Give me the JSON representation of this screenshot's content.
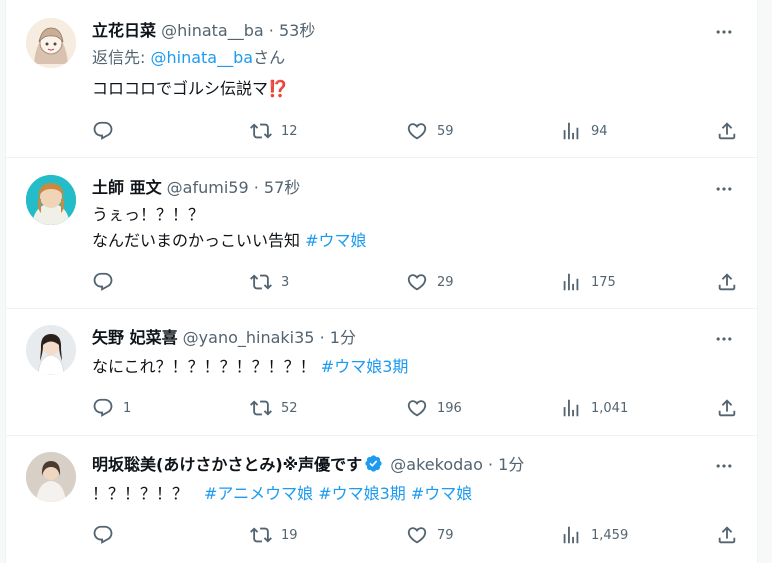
{
  "tweets": [
    {
      "name": "立花日菜",
      "handle": "@hinata__ba",
      "sep": "·",
      "time": "53秒",
      "reply_prefix": "返信先: ",
      "reply_to": "@hinata__ba",
      "reply_suffix": "さん",
      "text": "コロコロでゴルシ伝説マ⁉️",
      "replies": "",
      "retweets": "12",
      "likes": "59",
      "views": "94"
    },
    {
      "name": "土師 亜文",
      "handle": "@afumi59",
      "sep": "·",
      "time": "57秒",
      "line1": "うぇっ！？！？",
      "line2": "なんだいまのかっこいい告知 ",
      "hashtag1": "#ウマ娘",
      "replies": "",
      "retweets": "3",
      "likes": "29",
      "views": "175"
    },
    {
      "name": "矢野 妃菜喜",
      "handle": "@yano_hinaki35",
      "sep": "·",
      "time": "1分",
      "text": "なにこれ？！？！？！？！？！ ",
      "hashtag1": "#ウマ娘3期",
      "replies": "1",
      "retweets": "52",
      "likes": "196",
      "views": "1,041"
    },
    {
      "name": "明坂聡美(あけさかさとみ)※声優です",
      "handle": "@akekodao",
      "sep": "·",
      "time": "1分",
      "text": "！？！？！？　",
      "hashtag1": "#アニメウマ娘",
      "hashtag2": "#ウマ娘3期",
      "hashtag3": "#ウマ娘",
      "replies": "",
      "retweets": "19",
      "likes": "79",
      "views": "1,459"
    }
  ],
  "colors": {
    "link": "#1d9bf0",
    "secondary": "#536471",
    "text": "#0f1419",
    "divider": "#eff3f4"
  },
  "icons": [
    "more-icon",
    "reply-icon",
    "retweet-icon",
    "like-icon",
    "views-icon",
    "share-icon",
    "verified-icon"
  ]
}
